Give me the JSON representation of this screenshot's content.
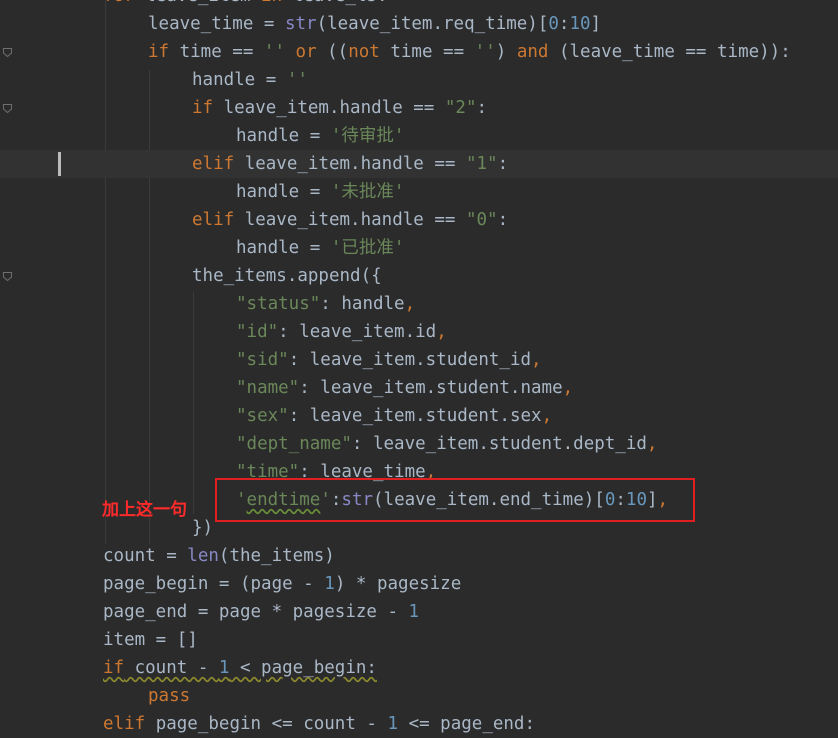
{
  "editor": {
    "lines": [
      [
        {
          "c": "kw",
          "t": "for"
        },
        {
          "c": "pl",
          "t": " leave_item "
        },
        {
          "c": "kw",
          "t": "in"
        },
        {
          "c": "pl",
          "t": " leave_ls:"
        }
      ],
      [
        {
          "c": "pl",
          "t": "leave_time = "
        },
        {
          "c": "bi",
          "t": "str"
        },
        {
          "c": "pl",
          "t": "(leave_item.req_time)["
        },
        {
          "c": "num",
          "t": "0"
        },
        {
          "c": "pl",
          "t": ":"
        },
        {
          "c": "num",
          "t": "10"
        },
        {
          "c": "pl",
          "t": "]"
        }
      ],
      [
        {
          "c": "kw",
          "t": "if"
        },
        {
          "c": "pl",
          "t": " time == "
        },
        {
          "c": "str",
          "t": "''"
        },
        {
          "c": "pl",
          "t": " "
        },
        {
          "c": "kw",
          "t": "or"
        },
        {
          "c": "pl",
          "t": " (("
        },
        {
          "c": "kw",
          "t": "not"
        },
        {
          "c": "pl",
          "t": " time == "
        },
        {
          "c": "str",
          "t": "''"
        },
        {
          "c": "pl",
          "t": ") "
        },
        {
          "c": "kw",
          "t": "and"
        },
        {
          "c": "pl",
          "t": " (leave_time == time)):"
        }
      ],
      [
        {
          "c": "pl",
          "t": "handle = "
        },
        {
          "c": "str",
          "t": "''"
        }
      ],
      [
        {
          "c": "kw",
          "t": "if"
        },
        {
          "c": "pl",
          "t": " leave_item.handle == "
        },
        {
          "c": "str",
          "t": "\"2\""
        },
        {
          "c": "pl",
          "t": ":"
        }
      ],
      [
        {
          "c": "pl",
          "t": "handle = "
        },
        {
          "c": "str",
          "t": "'待审批'"
        }
      ],
      [
        {
          "c": "kw",
          "t": "elif"
        },
        {
          "c": "pl",
          "t": " leave_item.handle == "
        },
        {
          "c": "str",
          "t": "\"1\""
        },
        {
          "c": "pl",
          "t": ":"
        }
      ],
      [
        {
          "c": "pl",
          "t": "handle = "
        },
        {
          "c": "str",
          "t": "'未批准'"
        }
      ],
      [
        {
          "c": "kw",
          "t": "elif"
        },
        {
          "c": "pl",
          "t": " leave_item.handle == "
        },
        {
          "c": "str",
          "t": "\"0\""
        },
        {
          "c": "pl",
          "t": ":"
        }
      ],
      [
        {
          "c": "pl",
          "t": "handle = "
        },
        {
          "c": "str",
          "t": "'已批准'"
        }
      ],
      [
        {
          "c": "pl",
          "t": "the_items.append({"
        }
      ],
      [
        {
          "c": "str",
          "t": "\"status\""
        },
        {
          "c": "pl",
          "t": ": handle"
        },
        {
          "c": "kw",
          "t": ","
        }
      ],
      [
        {
          "c": "str",
          "t": "\"id\""
        },
        {
          "c": "pl",
          "t": ": leave_item.id"
        },
        {
          "c": "kw",
          "t": ","
        }
      ],
      [
        {
          "c": "str",
          "t": "\"sid\""
        },
        {
          "c": "pl",
          "t": ": leave_item.student_id"
        },
        {
          "c": "kw",
          "t": ","
        }
      ],
      [
        {
          "c": "str",
          "t": "\"name\""
        },
        {
          "c": "pl",
          "t": ": leave_item.student.name"
        },
        {
          "c": "kw",
          "t": ","
        }
      ],
      [
        {
          "c": "str",
          "t": "\"sex\""
        },
        {
          "c": "pl",
          "t": ": leave_item.student.sex"
        },
        {
          "c": "kw",
          "t": ","
        }
      ],
      [
        {
          "c": "str",
          "t": "\"dept_name\""
        },
        {
          "c": "pl",
          "t": ": leave_item.student.dept_id"
        },
        {
          "c": "kw",
          "t": ","
        }
      ],
      [
        {
          "c": "str",
          "t": "\"time\""
        },
        {
          "c": "pl",
          "t": ": leave_time"
        },
        {
          "c": "kw",
          "t": ","
        }
      ],
      [
        {
          "c": "str",
          "t": "'"
        },
        {
          "c": "str spell",
          "t": "endtime"
        },
        {
          "c": "str",
          "t": "'"
        },
        {
          "c": "pl",
          "t": ":"
        },
        {
          "c": "bi",
          "t": "str"
        },
        {
          "c": "pl",
          "t": "(leave_item.end_time)["
        },
        {
          "c": "num",
          "t": "0"
        },
        {
          "c": "pl",
          "t": ":"
        },
        {
          "c": "num",
          "t": "10"
        },
        {
          "c": "pl",
          "t": "]"
        },
        {
          "c": "kw",
          "t": ","
        }
      ],
      [
        {
          "c": "pl",
          "t": "})"
        }
      ],
      [
        {
          "c": "pl",
          "t": "count = "
        },
        {
          "c": "bi",
          "t": "len"
        },
        {
          "c": "pl",
          "t": "(the_items)"
        }
      ],
      [
        {
          "c": "pl",
          "t": "page_begin = (page - "
        },
        {
          "c": "num",
          "t": "1"
        },
        {
          "c": "pl",
          "t": ") * pagesize"
        }
      ],
      [
        {
          "c": "pl",
          "t": "page_end = page * pagesize - "
        },
        {
          "c": "num",
          "t": "1"
        }
      ],
      [
        {
          "c": "pl",
          "t": "item = []"
        }
      ],
      [
        {
          "c": "kw warn",
          "t": "if"
        },
        {
          "c": "pl warn",
          "t": " count - "
        },
        {
          "c": "num warn",
          "t": "1"
        },
        {
          "c": "pl warn",
          "t": " < page_begin:"
        }
      ],
      [
        {
          "c": "kw",
          "t": "pass"
        }
      ],
      [
        {
          "c": "kw",
          "t": "elif"
        },
        {
          "c": "pl",
          "t": " page_begin <= count - "
        },
        {
          "c": "num",
          "t": "1"
        },
        {
          "c": "pl",
          "t": " <= page_end:"
        }
      ]
    ]
  },
  "annotation": {
    "label": "加上这一句"
  }
}
